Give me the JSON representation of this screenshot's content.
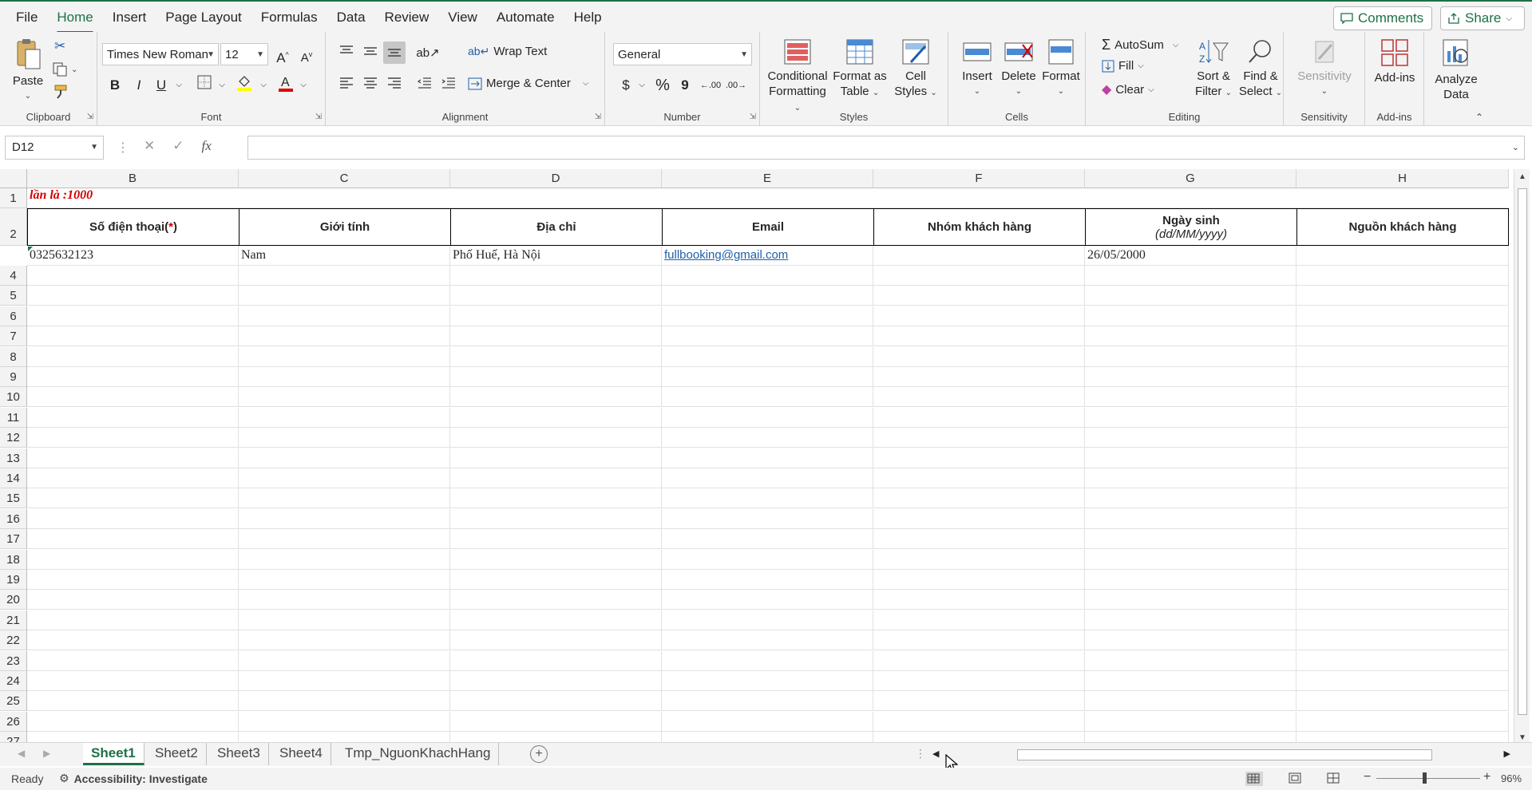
{
  "menu": {
    "tabs": [
      "File",
      "Home",
      "Insert",
      "Page Layout",
      "Formulas",
      "Data",
      "Review",
      "View",
      "Automate",
      "Help"
    ],
    "active": "Home",
    "comments_label": "Comments",
    "share_label": "Share"
  },
  "ribbon": {
    "clipboard": {
      "label": "Clipboard",
      "paste": "Paste"
    },
    "font": {
      "label": "Font",
      "font_name": "Times New Roman",
      "font_size": "12",
      "bold": "B",
      "italic": "I",
      "underline": "U"
    },
    "alignment": {
      "label": "Alignment",
      "wrap_text": "Wrap Text",
      "merge_center": "Merge & Center"
    },
    "number": {
      "label": "Number",
      "format": "General",
      "currency": "$",
      "percent": "%",
      "comma": "9"
    },
    "styles": {
      "label": "Styles",
      "conditional_1": "Conditional",
      "conditional_2": "Formatting",
      "format_table_1": "Format as",
      "format_table_2": "Table",
      "cell_styles_1": "Cell",
      "cell_styles_2": "Styles"
    },
    "cells": {
      "label": "Cells",
      "insert": "Insert",
      "delete": "Delete",
      "format": "Format"
    },
    "editing": {
      "label": "Editing",
      "autosum": "AutoSum",
      "fill": "Fill",
      "clear": "Clear",
      "sort_1": "Sort &",
      "sort_2": "Filter",
      "find_1": "Find &",
      "find_2": "Select"
    },
    "sensitivity": {
      "label": "Sensitivity",
      "button": "Sensitivity"
    },
    "addins": {
      "label": "Add-ins",
      "button": "Add-ins"
    },
    "analyze": {
      "line1": "Analyze",
      "line2": "Data"
    }
  },
  "formula_bar": {
    "name_box": "D12",
    "fx": "fx",
    "content": ""
  },
  "grid": {
    "columns": [
      "B",
      "C",
      "D",
      "E",
      "F",
      "G",
      "H"
    ],
    "rows": [
      "1",
      "2",
      "3",
      "4",
      "5",
      "6",
      "7",
      "8",
      "9",
      "10",
      "11",
      "12",
      "13",
      "14",
      "15",
      "16",
      "17",
      "18",
      "19",
      "20",
      "21",
      "22",
      "23",
      "24",
      "25",
      "26",
      "27"
    ],
    "row1_text": "lần là :1000",
    "headers": {
      "phone": "Số điện thoại(",
      "phone_star": "*",
      "phone_close": ")",
      "gender": "Giới tính",
      "address": "Địa chỉ",
      "email": "Email",
      "group": "Nhóm khách hàng",
      "birthday": "Ngày sinh",
      "birthday_fmt": "(dd/MM/yyyy)",
      "source": "Nguồn khách hàng"
    },
    "row3": {
      "phone": "0325632123",
      "gender": "Nam",
      "address": "Phố Huế, Hà Nội",
      "email": "fullbooking@gmail.com",
      "group": "",
      "birthday": "26/05/2000",
      "source": ""
    }
  },
  "sheets": {
    "tabs": [
      "Sheet1",
      "Sheet2",
      "Sheet3",
      "Sheet4",
      "Tmp_NguonKhachHang"
    ],
    "active": "Sheet1"
  },
  "status": {
    "ready": "Ready",
    "accessibility": "Accessibility: Investigate",
    "zoom": "96%"
  },
  "colors": {
    "accent": "#1e7145",
    "red": "#d10000",
    "link": "#1f5fa8"
  }
}
